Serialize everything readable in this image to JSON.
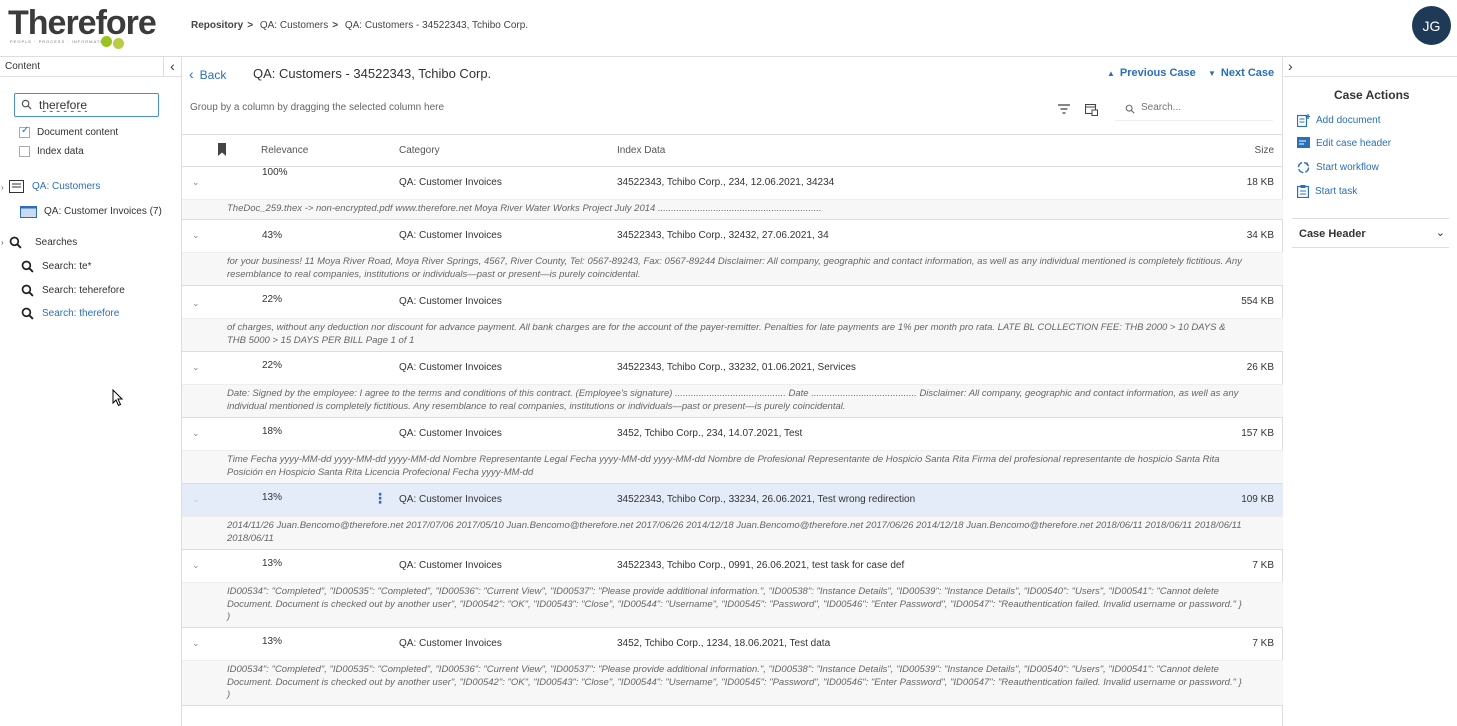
{
  "app": {
    "logo_text": "Therefore",
    "logo_tagline": "PEOPLE · PROCESS · INFORMATION",
    "user_initials": "JG",
    "accent_color": "#2a6fb8",
    "avatar_color": "#1f3a56"
  },
  "breadcrumb": [
    "Repository",
    ">",
    "QA: Customers",
    ">",
    "QA: Customers - 34522343, Tchibo Corp."
  ],
  "sidebar": {
    "title": "Content",
    "collapse_icon": "chevron-left-icon",
    "search_value": "therefore",
    "options": [
      {
        "label": "Document content",
        "checked": true
      },
      {
        "label": "Index data",
        "checked": false
      }
    ],
    "tree": {
      "customers_label": "QA: Customers",
      "invoices_label": "QA: Customer Invoices (7)",
      "searches_label": "Searches",
      "searches": [
        "Search: te*",
        "Search: teherefore",
        "Search: therefore"
      ]
    }
  },
  "main": {
    "back_label": "Back",
    "case_title": "QA: Customers - 34522343, Tchibo Corp.",
    "prev_label": "Previous Case",
    "next_label": "Next Case",
    "group_hint": "Group by a column by dragging the selected column here",
    "search_placeholder": "Search...",
    "columns": {
      "relevance": "Relevance",
      "category": "Category",
      "index_data": "Index Data",
      "size": "Size"
    },
    "rows": [
      {
        "relevance": "100%",
        "category": "QA: Customer Invoices",
        "index": "34522343, Tchibo Corp., 234, 12.06.2021, 34234",
        "size": "18 KB",
        "snippet": "TheDoc_259.thex -> non-encrypted.pdf www.therefore.net Moya River Water Works Project July 2014 .............................................................."
      },
      {
        "relevance": "43%",
        "category": "QA: Customer Invoices",
        "index": "34522343, Tchibo Corp., 32432, 27.06.2021, 34",
        "size": "34 KB",
        "snippet": "for your business! 11 Moya River Road, Moya River Springs, 4567, River County, Tel: 0567-89243, Fax: 0567-89244 Disclaimer: All company, geographic and contact information, as well as any individual mentioned is completely fictitious. Any resemblance to real companies, institutions or individuals—past or present—is purely coincidental."
      },
      {
        "relevance": "22%",
        "category": "QA: Customer Invoices",
        "index": "",
        "size": "554 KB",
        "snippet": "of charges, without any deduction nor discount for advance payment. All bank charges are for the account of the payer-remitter. Penalties for late payments are 1% per month pro rata. LATE BL COLLECTION FEE: THB 2000 > 10 DAYS & THB 5000 > 15 DAYS PER BILL Page 1 of 1"
      },
      {
        "relevance": "22%",
        "category": "QA: Customer Invoices",
        "index": "34522343, Tchibo Corp., 33232, 01.06.2021, Services",
        "size": "26 KB",
        "snippet": "Date: Signed by the employee: I agree to the terms and conditions of this contract. (Employee's signature) .......................................... Date ........................................ Disclaimer: All company, geographic and contact information, as well as any individual mentioned is completely fictitious. Any resemblance to real companies, institutions or individuals—past or present—is purely coincidental."
      },
      {
        "relevance": "18%",
        "category": "QA: Customer Invoices",
        "index": "3452, Tchibo Corp., 234, 14.07.2021, Test",
        "size": "157 KB",
        "snippet": "Time Fecha yyyy-MM-dd yyyy-MM-dd yyyy-MM-dd Nombre Representante Legal Fecha yyyy-MM-dd yyyy-MM-dd Nombre de Profesional Representante de Hospicio Santa Rita Firma del profesional representante de hospicio Santa Rita Posición en Hospicio Santa Rita Licencia Profecional Fecha yyyy-MM-dd"
      },
      {
        "relevance": "13%",
        "category": "QA: Customer Invoices",
        "index": "34522343, Tchibo Corp., 33234, 26.06.2021, Test wrong redirection",
        "size": "109 KB",
        "selected": true,
        "snippet": "2014/11/26 Juan.Bencomo@therefore.net 2017/07/06 2017/05/10 Juan.Bencomo@therefore.net 2017/06/26 2014/12/18 Juan.Bencomo@therefore.net 2017/06/26 2014/12/18 Juan.Bencomo@therefore.net 2018/06/11 2018/06/11 2018/06/11 2018/06/11"
      },
      {
        "relevance": "13%",
        "category": "QA: Customer Invoices",
        "index": "34522343, Tchibo Corp., 0991, 26.06.2021, test task for case def",
        "size": "7 KB",
        "snippet": "ID00534\": \"Completed\", \"ID00535\": \"Completed\", \"ID00536\": \"Current View\", \"ID00537\": \"Please provide additional information.\", \"ID00538\": \"Instance Details\", \"ID00539\": \"Instance Details\", \"ID00540\": \"Users\", \"ID00541\": \"Cannot delete Document. Document is checked out by another user\", \"ID00542\": \"OK\", \"ID00543\": \"Close\", \"ID00544\": \"Username\", \"ID00545\": \"Password\", \"ID00546\": \"Enter Password\", \"ID00547\": \"Reauthentication failed. Invalid username or password.\" } )"
      },
      {
        "relevance": "13%",
        "category": "QA: Customer Invoices",
        "index": "3452, Tchibo Corp., 1234, 18.06.2021, Test data",
        "size": "7 KB",
        "snippet": "ID00534\": \"Completed\", \"ID00535\": \"Completed\", \"ID00536\": \"Current View\", \"ID00537\": \"Please provide additional information.\", \"ID00538\": \"Instance Details\", \"ID00539\": \"Instance Details\", \"ID00540\": \"Users\", \"ID00541\": \"Cannot delete Document. Document is checked out by another user\", \"ID00542\": \"OK\", \"ID00543\": \"Close\", \"ID00544\": \"Username\", \"ID00545\": \"Password\", \"ID00546\": \"Enter Password\", \"ID00547\": \"Reauthentication failed. Invalid username or password.\" } )"
      }
    ]
  },
  "right_panel": {
    "title": "Case Actions",
    "actions": [
      "Add document",
      "Edit case header",
      "Start workflow",
      "Start task"
    ],
    "case_header_label": "Case Header"
  }
}
